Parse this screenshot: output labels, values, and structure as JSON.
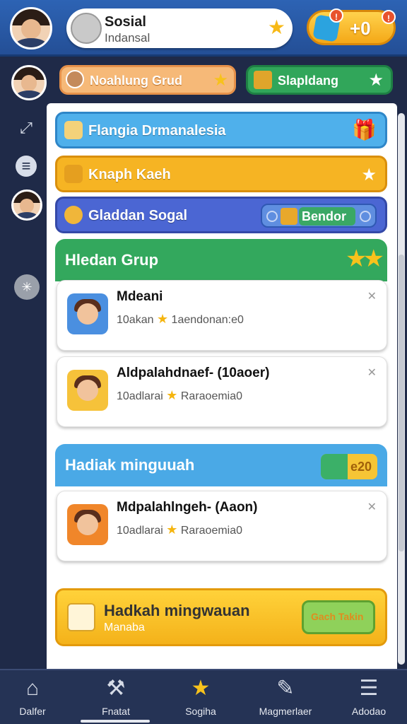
{
  "header": {
    "profile_name": "Sosial",
    "profile_sub": "Indansal",
    "currency_value": "+0",
    "currency_badge": "!",
    "top_badge": "!"
  },
  "row2": {
    "group_label": "Noahlung Grud",
    "green_label": "Slapldang"
  },
  "menu": {
    "bar1": "Flangia Drmanalesia",
    "bar2": "Knaph Kaeh",
    "bar3": "Gladdan Sogal",
    "bar3_button": "Bendor"
  },
  "section1": {
    "title": "Hledan Grup",
    "cards": [
      {
        "name": "Mdeani",
        "meta_left": "10akan",
        "meta_right": "1aendonan:e0"
      },
      {
        "name": "Aldpalahdnaef- (10aoer)",
        "meta_left": "10adlarai",
        "meta_right": "Raraoemia0"
      }
    ]
  },
  "section2": {
    "title": "Hadiak minguuah",
    "chip_value": "e20",
    "cards": [
      {
        "name": "Mdpalahlngeh- (Aaon)",
        "meta_left": "10adlarai",
        "meta_right": "Raraoemia0"
      }
    ]
  },
  "promo": {
    "title": "Hadkah mingwauan",
    "subtitle": "Manaba",
    "button": "Gach Takin"
  },
  "bottom_nav": [
    {
      "label": "Dalfer",
      "icon": "home-icon"
    },
    {
      "label": "Fnatat",
      "icon": "tools-icon"
    },
    {
      "label": "Sogiha",
      "icon": "star-icon"
    },
    {
      "label": "Magmerlaer",
      "icon": "edit-icon"
    },
    {
      "label": "Adodao",
      "icon": "menu-icon"
    }
  ],
  "colors": {
    "header_blue": "#2d63b4",
    "sidebar_navy": "#1f2a48",
    "section_green": "#33a85d",
    "section_blue": "#4aa9e6",
    "accent_yellow": "#f6b423",
    "accent_indigo": "#4b66d3"
  }
}
